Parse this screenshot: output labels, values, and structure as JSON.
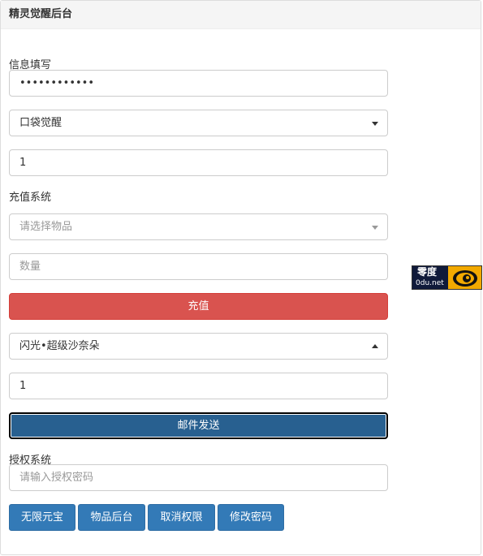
{
  "panel": {
    "title": "精灵觉醒后台"
  },
  "info": {
    "section_label": "信息填写",
    "password_value": "••••••••••••",
    "game_select": "口袋觉醒",
    "quantity_value": "1"
  },
  "recharge": {
    "section_label": "充值系统",
    "item_placeholder": "请选择物品",
    "amount_placeholder": "数量",
    "submit_label": "充值"
  },
  "mail": {
    "item_select": "闪光•超级沙奈朵",
    "quantity_value": "1",
    "send_label": "邮件发送"
  },
  "auth": {
    "section_label": "授权系统",
    "password_placeholder": "请输入授权密码",
    "buttons": [
      "无限元宝",
      "物品后台",
      "取消权限",
      "修改密码"
    ]
  },
  "badge": {
    "line1": "零度",
    "line2": "0du.net"
  }
}
